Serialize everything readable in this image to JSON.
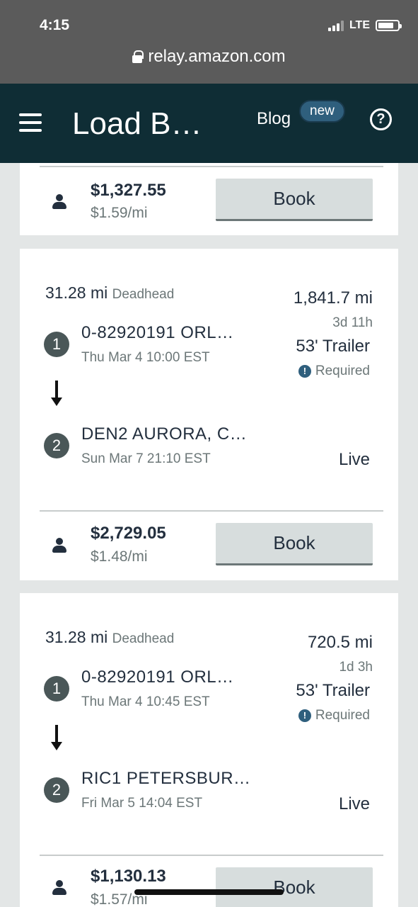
{
  "status_bar": {
    "time": "4:15",
    "network": "LTE"
  },
  "browser": {
    "url": "relay.amazon.com"
  },
  "header": {
    "title": "Load B…",
    "blog_label": "Blog",
    "new_badge": "new",
    "help_symbol": "?"
  },
  "loads": [
    {
      "price": "$1,327.55",
      "rate": "$1.59/mi",
      "book_label": "Book"
    },
    {
      "deadhead_value": "31.28 mi",
      "deadhead_label": "Deadhead",
      "total_distance": "1,841.7 mi",
      "duration": "3d 11h",
      "trailer": "53' Trailer",
      "required_label": "Required",
      "stops": [
        {
          "number": "1",
          "name": "0-82920191 ORL…",
          "time": "Thu Mar 4 10:00 EST"
        },
        {
          "number": "2",
          "name": "DEN2 AURORA, C…",
          "time": "Sun Mar 7 21:10 EST"
        }
      ],
      "load_type": "Live",
      "price": "$2,729.05",
      "rate": "$1.48/mi",
      "book_label": "Book"
    },
    {
      "deadhead_value": "31.28 mi",
      "deadhead_label": "Deadhead",
      "total_distance": "720.5 mi",
      "duration": "1d 3h",
      "trailer": "53' Trailer",
      "required_label": "Required",
      "stops": [
        {
          "number": "1",
          "name": "0-82920191 ORL…",
          "time": "Thu Mar 4 10:45 EST"
        },
        {
          "number": "2",
          "name": "RIC1 PETERSBUR…",
          "time": "Fri Mar 5 14:04 EST"
        }
      ],
      "load_type": "Live",
      "price": "$1,130.13",
      "rate": "$1.57/mi",
      "book_label": "Book"
    }
  ]
}
